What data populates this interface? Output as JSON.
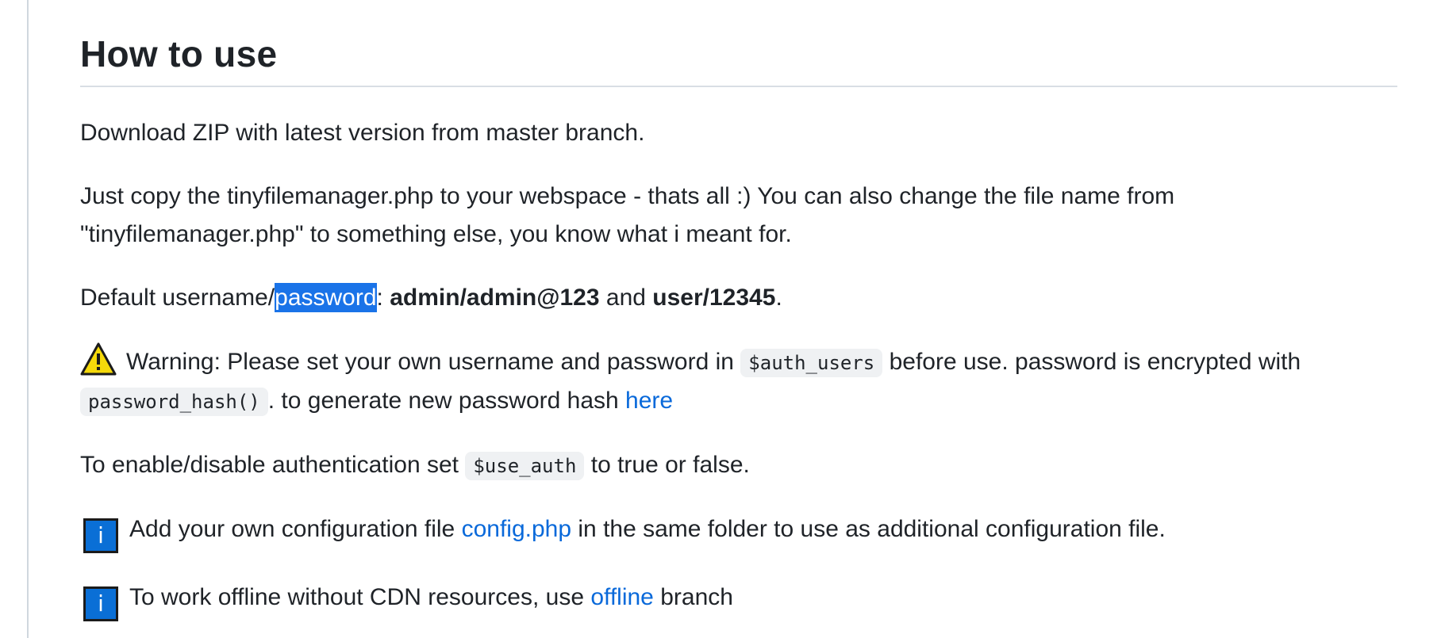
{
  "heading": "How to use",
  "p1": {
    "text": "Download ZIP with latest version from master branch."
  },
  "p2": {
    "text": "Just copy the tinyfilemanager.php to your webspace - thats all :) You can also change the file name from \"tinyfilemanager.php\" to something else, you know what i meant for."
  },
  "p3": {
    "prefix": "Default username/",
    "selected": "password",
    "colon": ": ",
    "cred1": "admin/admin@123",
    "and": " and ",
    "cred2": "user/12345",
    "end": "."
  },
  "p4": {
    "icon": "warning-icon",
    "text1": "Warning: Please set your own username and password in ",
    "code1": "$auth_users",
    "text2": " before use. password is encrypted with ",
    "code2": "password_hash()",
    "text3": ". to generate new password hash ",
    "link": "here"
  },
  "p5": {
    "text1": "To enable/disable authentication set ",
    "code": "$use_auth",
    "text2": " to true or false."
  },
  "p6": {
    "icon": "info-icon",
    "icon_glyph": "i",
    "text1": "Add your own configuration file ",
    "link": "config.php",
    "text2": " in the same folder to use as additional configuration file."
  },
  "p7": {
    "icon": "info-icon",
    "icon_glyph": "i",
    "text1": "To work offline without CDN resources, use ",
    "link": "offline",
    "text2": " branch"
  },
  "colors": {
    "link": "#0969da",
    "selection": "#1a73e8",
    "info_icon": "#0a6fd6",
    "warning_icon": "#f5d90a"
  }
}
